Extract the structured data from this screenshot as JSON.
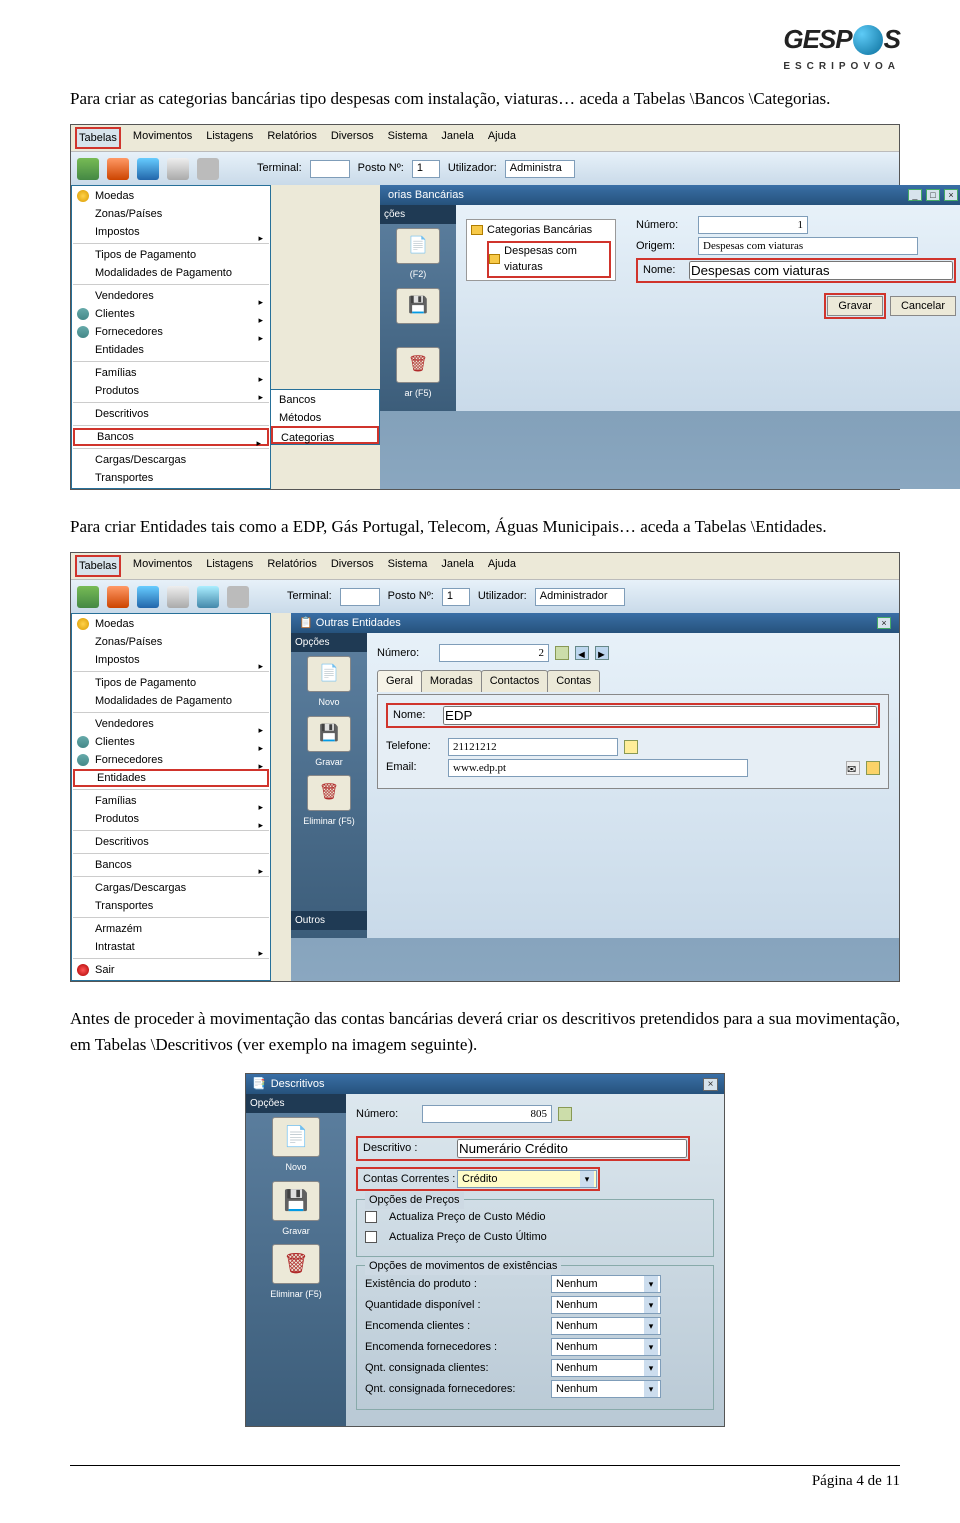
{
  "logo": {
    "left": "GESP",
    "right": "S",
    "sub": "ESCRIPOVOA"
  },
  "paragraphs": {
    "p1": "Para criar as categorias bancárias tipo despesas com instalação, viaturas… aceda a Tabelas \\Bancos \\Categorias.",
    "p2": "Para criar Entidades tais como a EDP, Gás Portugal, Telecom, Águas Municipais… aceda a Tabelas \\Entidades.",
    "p3": "Antes de proceder à movimentação das contas bancárias deverá criar os descritivos pretendidos para a sua movimentação, em Tabelas \\Descritivos (ver exemplo na imagem seguinte)."
  },
  "menubar": {
    "items": [
      "Tabelas",
      "Movimentos",
      "Listagens",
      "Relatórios",
      "Diversos",
      "Sistema",
      "Janela",
      "Ajuda"
    ]
  },
  "toolbar": {
    "terminal_label": "Terminal:",
    "posto_label": "Posto Nº:",
    "posto_value": "1",
    "util_label": "Utilizador:",
    "util_value_short": "Administra",
    "util_value": "Administrador"
  },
  "menu_items": {
    "moedas": "Moedas",
    "zonas": "Zonas/Países",
    "impostos": "Impostos",
    "tipos_pag": "Tipos de Pagamento",
    "modalidades": "Modalidades de Pagamento",
    "vendedores": "Vendedores",
    "clientes": "Clientes",
    "fornecedores": "Fornecedores",
    "entidades": "Entidades",
    "familias": "Famílias",
    "produtos": "Produtos",
    "descritivos": "Descritivos",
    "bancos": "Bancos",
    "cargas": "Cargas/Descargas",
    "transportes": "Transportes",
    "armazem": "Armazém",
    "intrastat": "Intrastat",
    "sair": "Sair"
  },
  "submenu_bancos": {
    "bancos": "Bancos",
    "metodos": "Métodos",
    "categorias": "Categorias"
  },
  "shot1": {
    "title": "orias Bancárias",
    "side_opcoes": "ções",
    "side_f2": "(F2)",
    "side_f5": "ar (F5)",
    "tree_root": "Categorias Bancárias",
    "tree_item": "Despesas com viaturas",
    "numero_label": "Número:",
    "numero_value": "1",
    "origem_label": "Origem:",
    "origem_value": "Despesas com viaturas",
    "nome_label": "Nome:",
    "nome_value": "Despesas com viaturas",
    "gravar": "Gravar",
    "cancelar": "Cancelar"
  },
  "shot2": {
    "title": "Outras Entidades",
    "side_opcoes": "Opções",
    "novo": "Novo",
    "gravar": "Gravar",
    "eliminar": "Eliminar (F5)",
    "outros": "Outros",
    "numero_label": "Número:",
    "numero_value": "2",
    "tabs": [
      "Geral",
      "Moradas",
      "Contactos",
      "Contas"
    ],
    "nome_label": "Nome:",
    "nome_value": "EDP",
    "telefone_label": "Telefone:",
    "telefone_value": "21121212",
    "email_label": "Email:",
    "email_value": "www.edp.pt"
  },
  "shot3": {
    "win_icon_title": "Descritivos",
    "side_opcoes": "Opções",
    "novo": "Novo",
    "gravar": "Gravar",
    "eliminar": "Eliminar (F5)",
    "numero_label": "Número:",
    "numero_value": "805",
    "descritivo_label": "Descritivo :",
    "descritivo_value": "Numerário Crédito",
    "contas_label": "Contas Correntes :",
    "contas_value": "Crédito",
    "fs1_legend": "Opções de Preços",
    "chk1": "Actualiza Preço de Custo Médio",
    "chk2": "Actualiza Preço de Custo Último",
    "fs2_legend": "Opções de movimentos de existências",
    "row1": "Existência do produto :",
    "row2": "Quantidade disponível :",
    "row3": "Encomenda clientes :",
    "row4": "Encomenda fornecedores :",
    "row5": "Qnt. consignada clientes:",
    "row6": "Qnt. consignada fornecedores:",
    "dropdown_value": "Nenhum"
  },
  "footer": "Página 4 de 11"
}
